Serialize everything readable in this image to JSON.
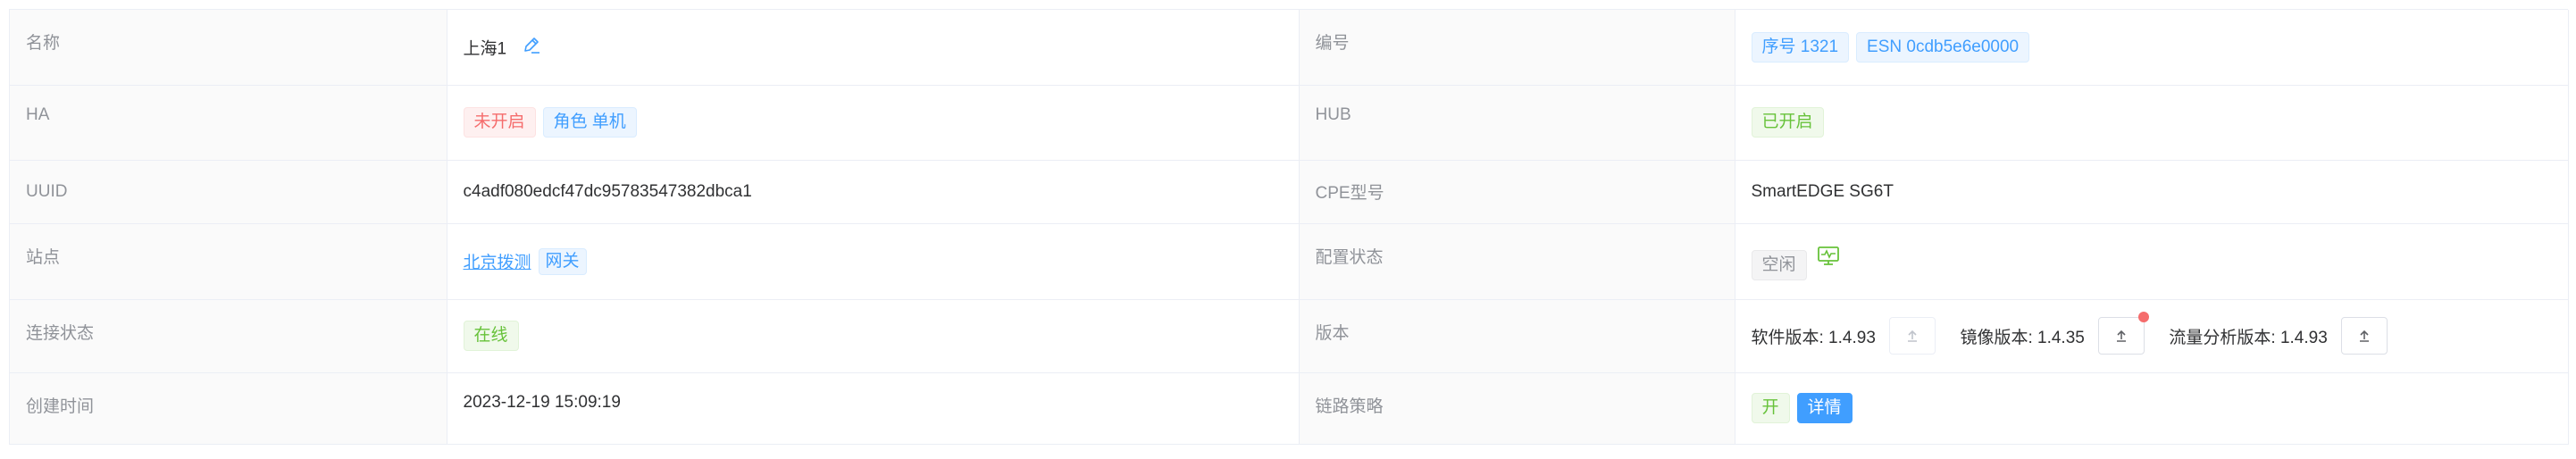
{
  "rows": [
    {
      "left_label": "名称",
      "name_value": "上海1",
      "right_label": "编号",
      "serial_tag": "序号 1321",
      "esn_tag": "ESN 0cdb5e6e0000"
    },
    {
      "left_label": "HA",
      "ha_status_tag": "未开启",
      "ha_role_tag": "角色 单机",
      "right_label": "HUB",
      "hub_tag": "已开启"
    },
    {
      "left_label": "UUID",
      "uuid_value": "c4adf080edcf47dc95783547382dbca1",
      "right_label": "CPE型号",
      "cpe_model": "SmartEDGE SG6T"
    },
    {
      "left_label": "站点",
      "site_link": "北京拨测",
      "site_tag": "网关",
      "right_label": "配置状态",
      "config_tag": "空闲"
    },
    {
      "left_label": "连接状态",
      "connection_tag": "在线",
      "right_label": "版本",
      "software_version": "软件版本: 1.4.93",
      "image_version": "镜像版本: 1.4.35",
      "traffic_version": "流量分析版本: 1.4.93"
    },
    {
      "left_label": "创建时间",
      "created_time": "2023-12-19 15:09:19",
      "right_label": "链路策略",
      "policy_tag": "开",
      "details_button": "详情"
    }
  ],
  "icons": {
    "edit": "pencil-icon",
    "monitor": "monitor-icon",
    "upload": "upload-arrow-icon"
  },
  "colors": {
    "primary": "#409eff",
    "success": "#67c23a",
    "danger": "#f56c6c",
    "info": "#909399",
    "notify_dot": "#f56c6c"
  }
}
